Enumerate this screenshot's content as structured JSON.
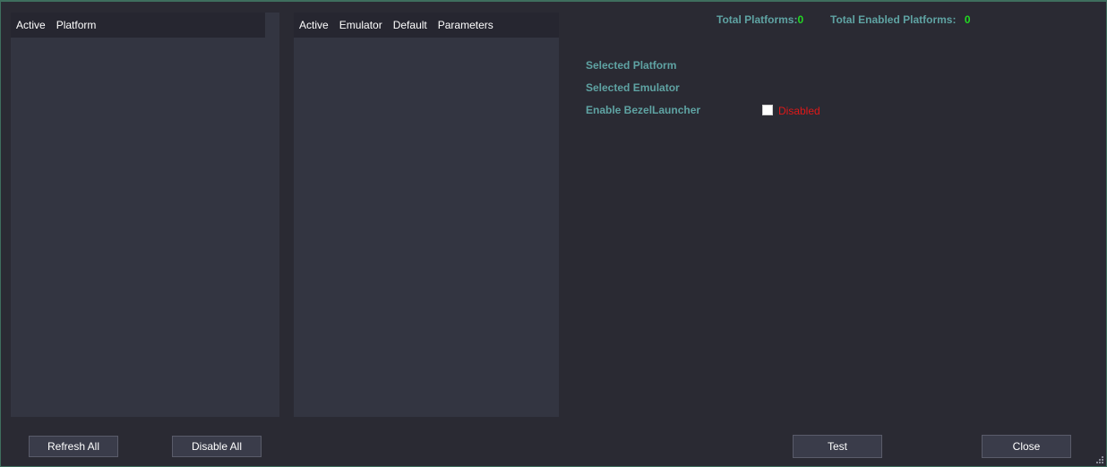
{
  "platforms_grid": {
    "columns": [
      "Active",
      "Platform"
    ]
  },
  "emulators_grid": {
    "columns": [
      "Active",
      "Emulator",
      "Default",
      "Parameters"
    ]
  },
  "stats": {
    "total_platforms_label": "Total Platforms:",
    "total_platforms_value": "0",
    "total_enabled_label": "Total Enabled Platforms:",
    "total_enabled_value": "0"
  },
  "details": {
    "selected_platform_label": "Selected Platform",
    "selected_emulator_label": "Selected Emulator",
    "enable_bezel_label": "Enable BezelLauncher",
    "bezel_checked": false,
    "bezel_status": "Disabled"
  },
  "buttons": {
    "refresh_all": "Refresh All",
    "disable_all": "Disable All",
    "test": "Test",
    "close": "Close"
  },
  "colors": {
    "background": "#2a2a33",
    "grid_background": "#333541",
    "label_teal": "#5fa3a3",
    "count_green": "#22d822",
    "disabled_red": "#e01818"
  }
}
